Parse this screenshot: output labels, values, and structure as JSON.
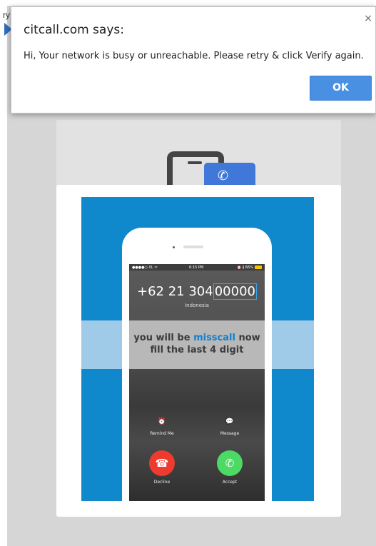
{
  "dialog": {
    "title": "citcall.com says:",
    "message": "Hi, Your network is busy or unreachable. Please retry & click Verify again.",
    "ok_label": "OK",
    "close_glyph": "×"
  },
  "page": {
    "edge_text": "ry"
  },
  "phone": {
    "status": {
      "carrier": "●●●●○ XL ᯤ",
      "time": "6:15 PM",
      "battery": "⏰ ∦ 66%"
    },
    "number_prefix": "+62 21 304",
    "number_highlight": "00000",
    "country": "Indonesia",
    "misscall_lead": "you will be ",
    "misscall_word": "misscall",
    "misscall_tail": " now",
    "misscall_line2": "fill the last 4 digit",
    "remind_label": "Remind Me",
    "message_label": "Message",
    "decline_label": "Decline",
    "accept_label": "Accept"
  },
  "icons": {
    "pointer": "arrow-pointer-icon",
    "close": "close-icon",
    "phone_handset": "phone-handset-icon",
    "alarm": "alarm-icon",
    "chat": "chat-bubble-icon",
    "decline": "decline-call-icon",
    "accept": "accept-call-icon"
  },
  "colors": {
    "ok_button": "#4a90e2",
    "brand_blue": "#1089cc",
    "accent_text": "#1080d0",
    "decline": "#ed3b30",
    "accept": "#4cd964"
  }
}
